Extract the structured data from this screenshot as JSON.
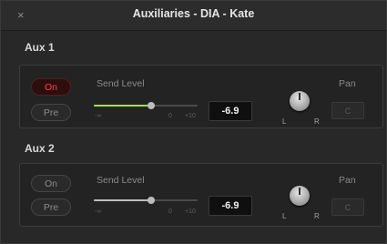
{
  "window": {
    "title": "Auxiliaries - DIA - Kate",
    "close_glyph": "×"
  },
  "colors": {
    "accent_green": "#a4e636",
    "on_red": "#ff4a3a",
    "slider_gray": "#bdbdbd"
  },
  "aux": [
    {
      "title": "Aux 1",
      "on_label": "On",
      "on_active": true,
      "pre_label": "Pre",
      "send_label": "Send Level",
      "scale": {
        "min": "-∞",
        "zero": "0",
        "max": "+10"
      },
      "level_fraction": 0.55,
      "value": "-6.9",
      "pan_label": "Pan",
      "pan_value": "C",
      "left": "L",
      "right": "R"
    },
    {
      "title": "Aux 2",
      "on_label": "On",
      "on_active": false,
      "pre_label": "Pre",
      "send_label": "Send Level",
      "scale": {
        "min": "-∞",
        "zero": "0",
        "max": "+10"
      },
      "level_fraction": 0.55,
      "value": "-6.9",
      "pan_label": "Pan",
      "pan_value": "C",
      "left": "L",
      "right": "R"
    }
  ]
}
